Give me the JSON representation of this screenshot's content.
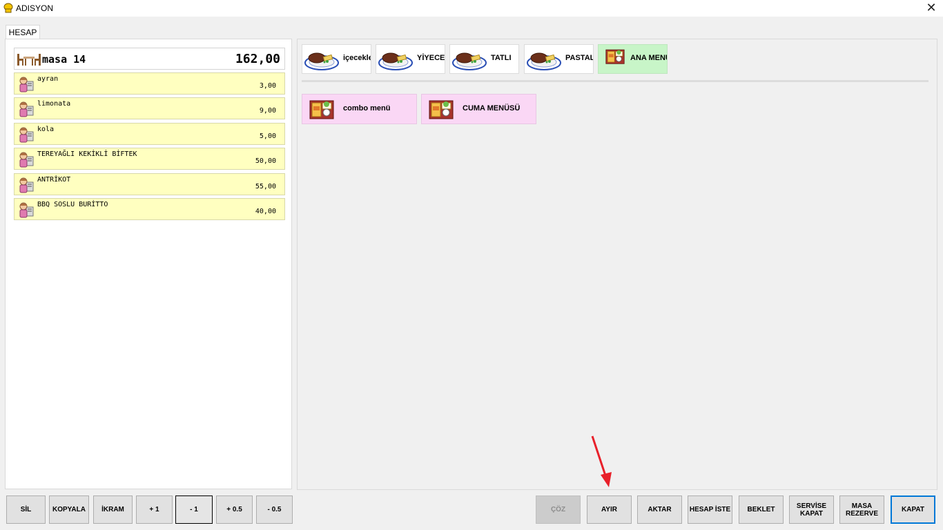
{
  "window": {
    "title": "ADISYON",
    "close_glyph": "✕",
    "app_icon": "chef-hat-icon"
  },
  "tab": {
    "label": "HESAP"
  },
  "bill": {
    "table_name": "masa 14",
    "total": "162,00",
    "items": [
      {
        "name": "ayran",
        "price": "3,00"
      },
      {
        "name": "limonata",
        "price": "9,00"
      },
      {
        "name": "kola",
        "price": "5,00"
      },
      {
        "name": "TEREYAĞLI KEKİKLİ BİFTEK",
        "price": "50,00"
      },
      {
        "name": "ANTRİKOT",
        "price": "55,00"
      },
      {
        "name": "BBQ SOSLU BURİTTO",
        "price": "40,00"
      }
    ]
  },
  "categories": [
    {
      "label": "içecekler",
      "icon": "steak-plate-icon"
    },
    {
      "label": "YİYECEKLER",
      "icon": "steak-plate-icon"
    },
    {
      "label": "TATLI",
      "icon": "steak-plate-icon"
    },
    {
      "label": "PASTALAR",
      "icon": "steak-plate-icon"
    },
    {
      "label": "ANA MENU",
      "icon": "bento-icon",
      "color": "#c8f5c8"
    }
  ],
  "menus": [
    {
      "label": "combo menü",
      "icon": "bento-icon",
      "color": "#fad7f5"
    },
    {
      "label": "CUMA MENÜSÜ",
      "icon": "bento-icon",
      "color": "#fad7f5"
    }
  ],
  "left_actions": {
    "delete": "SİL",
    "copy": "KOPYALA",
    "treat": "İKRAM",
    "plus_one": "+ 1",
    "minus_one": "- 1",
    "plus_half": "+ 0.5",
    "minus_half": "- 0.5"
  },
  "right_actions": {
    "resolve": "ÇÖZ",
    "split": "AYIR",
    "transfer": "AKTAR",
    "request_bill": "HESAP İSTE",
    "hold": "BEKLET",
    "close_service": "SERVİSE KAPAT",
    "reserve_table": "MASA REZERVE",
    "close": "KAPAT"
  },
  "accent_colors": {
    "order_item_bg": "#ffffc0",
    "default_button_border": "#0078d7",
    "annotation_arrow": "#e8202a"
  }
}
